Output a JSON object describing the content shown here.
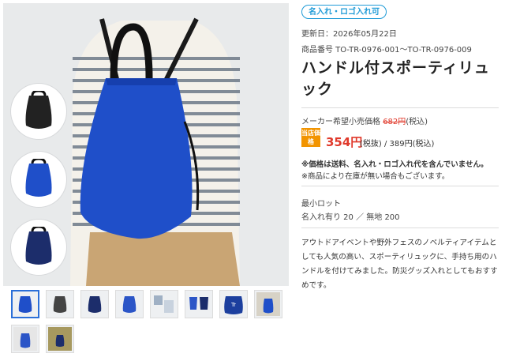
{
  "badge": "名入れ・ロゴ入れ可",
  "updated": "更新日：2026年05月22日",
  "product_code": "商品番号 TO-TR-0976-001〜TO-TR-0976-009",
  "title": "ハンドル付スポーティリュック",
  "maker_price_label": "メーカー希望小売価格",
  "maker_price_value": "682円",
  "maker_price_tax": "(税込)",
  "shop_price_label": "当店価格",
  "price_main": "354円",
  "price_rest": "(税抜) / 389円(税込)",
  "note1": "※価格は送料、名入れ・ロゴ入れ代を含んでいません。",
  "note2": "※商品により在庫が無い場合もございます。",
  "lot_label": "最小ロット",
  "lot_values": "名入れ有り 20 ／ 無地 200",
  "description": "アウトドアイベントや野外フェスのノベルティアイテムとしても人気の高い、スポーティリュックに、手持ち用のハンドルを付けてみました。防災グッズ入れとしてもおすすめです。",
  "colors": {
    "accent": "#1f9bd7",
    "price": "#e0392b",
    "shop_badge": "#f29400",
    "bag_blue": "#1f4fc9",
    "bag_navy": "#1c2d6b",
    "bag_black": "#222222"
  },
  "thumbnails": [
    "blue-bag-thumb",
    "black-bag-thumb",
    "navy-bag-thumb",
    "blue-bag-thumb",
    "lifestyle-thumb",
    "pair-bags-thumb",
    "print-example-thumb",
    "model-blue-thumb",
    "lifestyle-thumb",
    "model-back-thumb",
    "model-kid-thumb"
  ]
}
